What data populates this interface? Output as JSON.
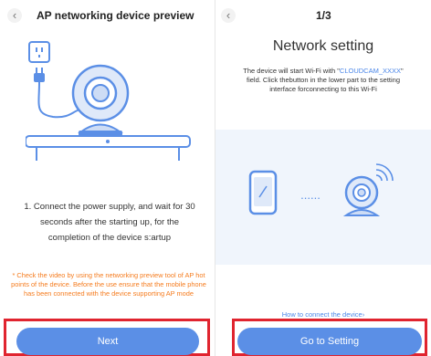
{
  "left": {
    "back_icon": "chevron-left-icon",
    "title": "AP networking device preview",
    "instruction": "1. Connect the power supply, and wait for 30 seconds after the starting up, for the completion of the device s:artup",
    "warning": "* Check the video by using the networking preview tool of AP hot points of the device. Before the use ensure that the mobile phone has been connected with the device supporting AP mode",
    "next_button": "Next"
  },
  "right": {
    "back_icon": "chevron-left-icon",
    "step": "1/3",
    "heading": "Network setting",
    "desc_pre": "The device will start Wi-Fi with \"",
    "desc_field": "CLOUDCAM_XXXX",
    "desc_post": "\" field. Click thebutton in the lower part to the setting interface forconnecting to this Wi-Fi",
    "dots": "......",
    "help_link": "How to connect the device›",
    "setting_button": "Go to Setting"
  },
  "colors": {
    "accent": "#5b8fe6",
    "warning": "#f57c1f",
    "highlight": "#e0242f",
    "link": "#4a86e8"
  }
}
